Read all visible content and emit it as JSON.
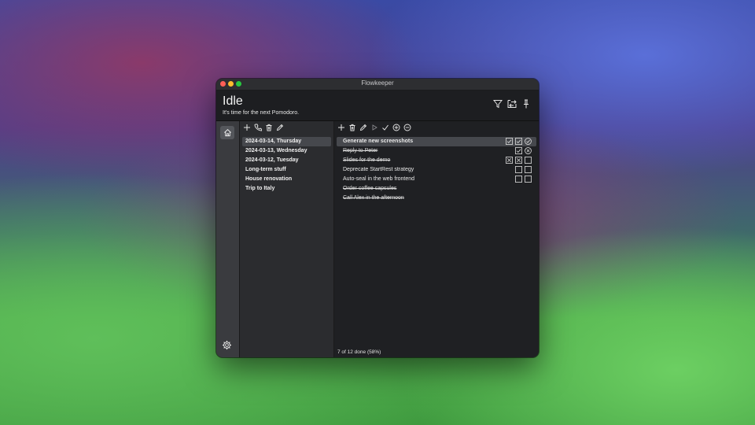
{
  "window": {
    "title": "Flowkeeper"
  },
  "header": {
    "status": "Idle",
    "subtitle": "It's time for the next Pomodoro.",
    "icons": [
      "filter-icon",
      "switch-icon",
      "pin-icon"
    ]
  },
  "sidebar": {
    "icons": [
      "home-icon",
      "gear-icon"
    ]
  },
  "backlogs": {
    "toolbar": [
      "plus-icon",
      "phone-icon",
      "trash-icon",
      "pencil-icon"
    ],
    "items": [
      {
        "label": "2024-03-14, Thursday",
        "selected": true
      },
      {
        "label": "2024-03-13, Wednesday",
        "selected": false
      },
      {
        "label": "2024-03-12, Tuesday",
        "selected": false
      },
      {
        "label": "Long-term stuff",
        "selected": false
      },
      {
        "label": "House renovation",
        "selected": false
      },
      {
        "label": "Trip to Italy",
        "selected": false
      }
    ]
  },
  "tasks": {
    "toolbar": [
      "plus-icon",
      "trash-icon",
      "pencil-icon",
      "play-icon",
      "check-icon",
      "plus-circle-icon",
      "minus-circle-icon"
    ],
    "items": [
      {
        "label": "Generate new screenshots",
        "done": false,
        "selected": true,
        "pomodoros": [
          "done",
          "done",
          "current"
        ]
      },
      {
        "label": "Reply to Peter",
        "done": true,
        "selected": false,
        "pomodoros": [
          "done",
          "void"
        ]
      },
      {
        "label": "Slides for the demo",
        "done": true,
        "selected": false,
        "pomodoros": [
          "failed",
          "failed",
          "new"
        ]
      },
      {
        "label": "Deprecate StartRest strategy",
        "done": false,
        "selected": false,
        "pomodoros": [
          "new",
          "new"
        ]
      },
      {
        "label": "Auto-seal in the web frontend",
        "done": false,
        "selected": false,
        "pomodoros": [
          "new",
          "new"
        ]
      },
      {
        "label": "Order coffee capsules",
        "done": true,
        "selected": false,
        "pomodoros": []
      },
      {
        "label": "Call Alex in the afternoon",
        "done": true,
        "selected": false,
        "pomodoros": []
      }
    ],
    "footer": "7 of 12 done (58%)"
  }
}
